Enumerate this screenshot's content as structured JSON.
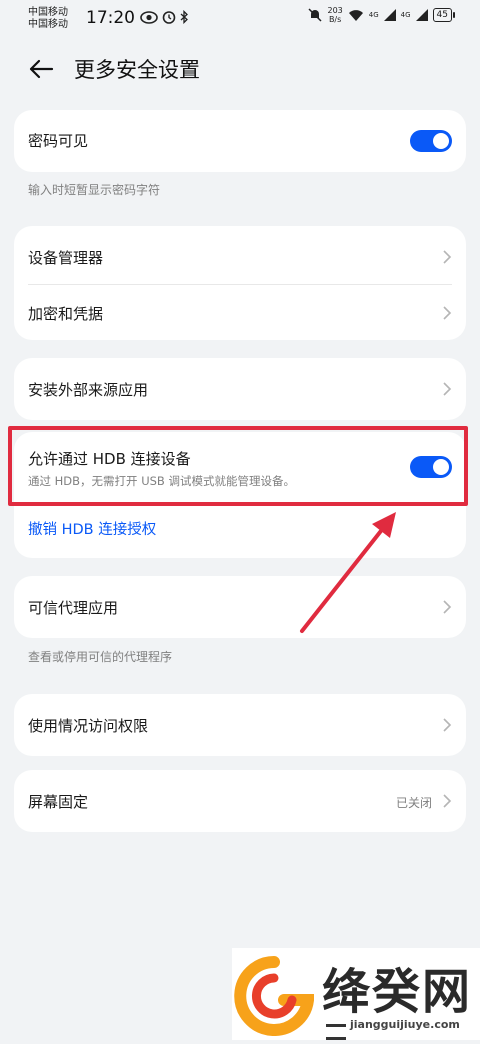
{
  "status": {
    "carrier1": "中国移动",
    "carrier2": "中国移动",
    "time": "17:20",
    "speed_value": "203",
    "speed_unit": "B/s",
    "signal1": "4G",
    "signal2": "4G",
    "battery": "45"
  },
  "header": {
    "title": "更多安全设置"
  },
  "password_visible": {
    "label": "密码可见",
    "enabled": true,
    "hint": "输入时短暂显示密码字符"
  },
  "group1": {
    "items": [
      {
        "label": "设备管理器"
      },
      {
        "label": "加密和凭据"
      }
    ]
  },
  "install_external": {
    "label": "安装外部来源应用"
  },
  "hdb": {
    "label": "允许通过 HDB 连接设备",
    "sub": "通过 HDB，无需打开 USB 调试模式就能管理设备。",
    "enabled": true,
    "revoke_link": "撤销 HDB 连接授权"
  },
  "trusted_agents": {
    "label": "可信代理应用",
    "hint": "查看或停用可信的代理程序"
  },
  "usage_access": {
    "label": "使用情况访问权限"
  },
  "screen_pinning": {
    "label": "屏幕固定",
    "value": "已关闭"
  },
  "watermark": {
    "title": "绛癸网",
    "url": "jiangguijiuye.com"
  },
  "colors": {
    "accent": "#0a59f7",
    "highlight": "#e02b3f",
    "background": "#f1f3f5"
  }
}
